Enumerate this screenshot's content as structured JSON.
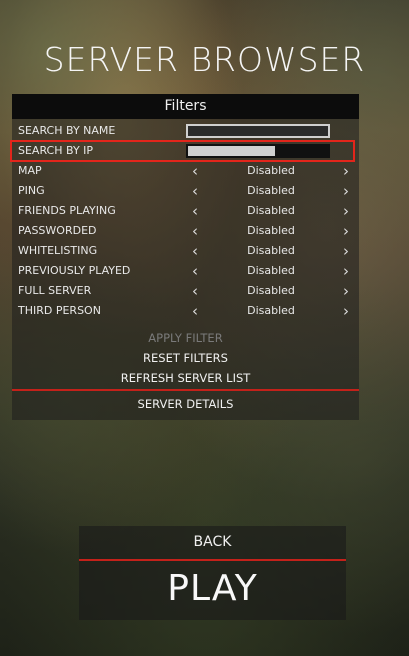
{
  "screen_title": "SERVER BROWSER",
  "filters": {
    "header": "Filters",
    "search_by_name": "SEARCH BY NAME",
    "search_by_ip": "SEARCH BY IP",
    "options": [
      {
        "label": "MAP",
        "value": "Disabled"
      },
      {
        "label": "PING",
        "value": "Disabled"
      },
      {
        "label": "FRIENDS PLAYING",
        "value": "Disabled"
      },
      {
        "label": "PASSWORDED",
        "value": "Disabled"
      },
      {
        "label": "WHITELISTING",
        "value": "Disabled"
      },
      {
        "label": "PREVIOUSLY PLAYED",
        "value": "Disabled"
      },
      {
        "label": "FULL SERVER",
        "value": "Disabled"
      },
      {
        "label": "THIRD PERSON",
        "value": "Disabled"
      }
    ],
    "apply_filter": "APPLY FILTER",
    "reset_filters": "RESET FILTERS",
    "refresh_server_list": "REFRESH SERVER LIST",
    "server_details": "SERVER DETAILS"
  },
  "nav": {
    "back": "BACK",
    "play": "PLAY"
  },
  "colors": {
    "accent_red": "#e3251b"
  }
}
